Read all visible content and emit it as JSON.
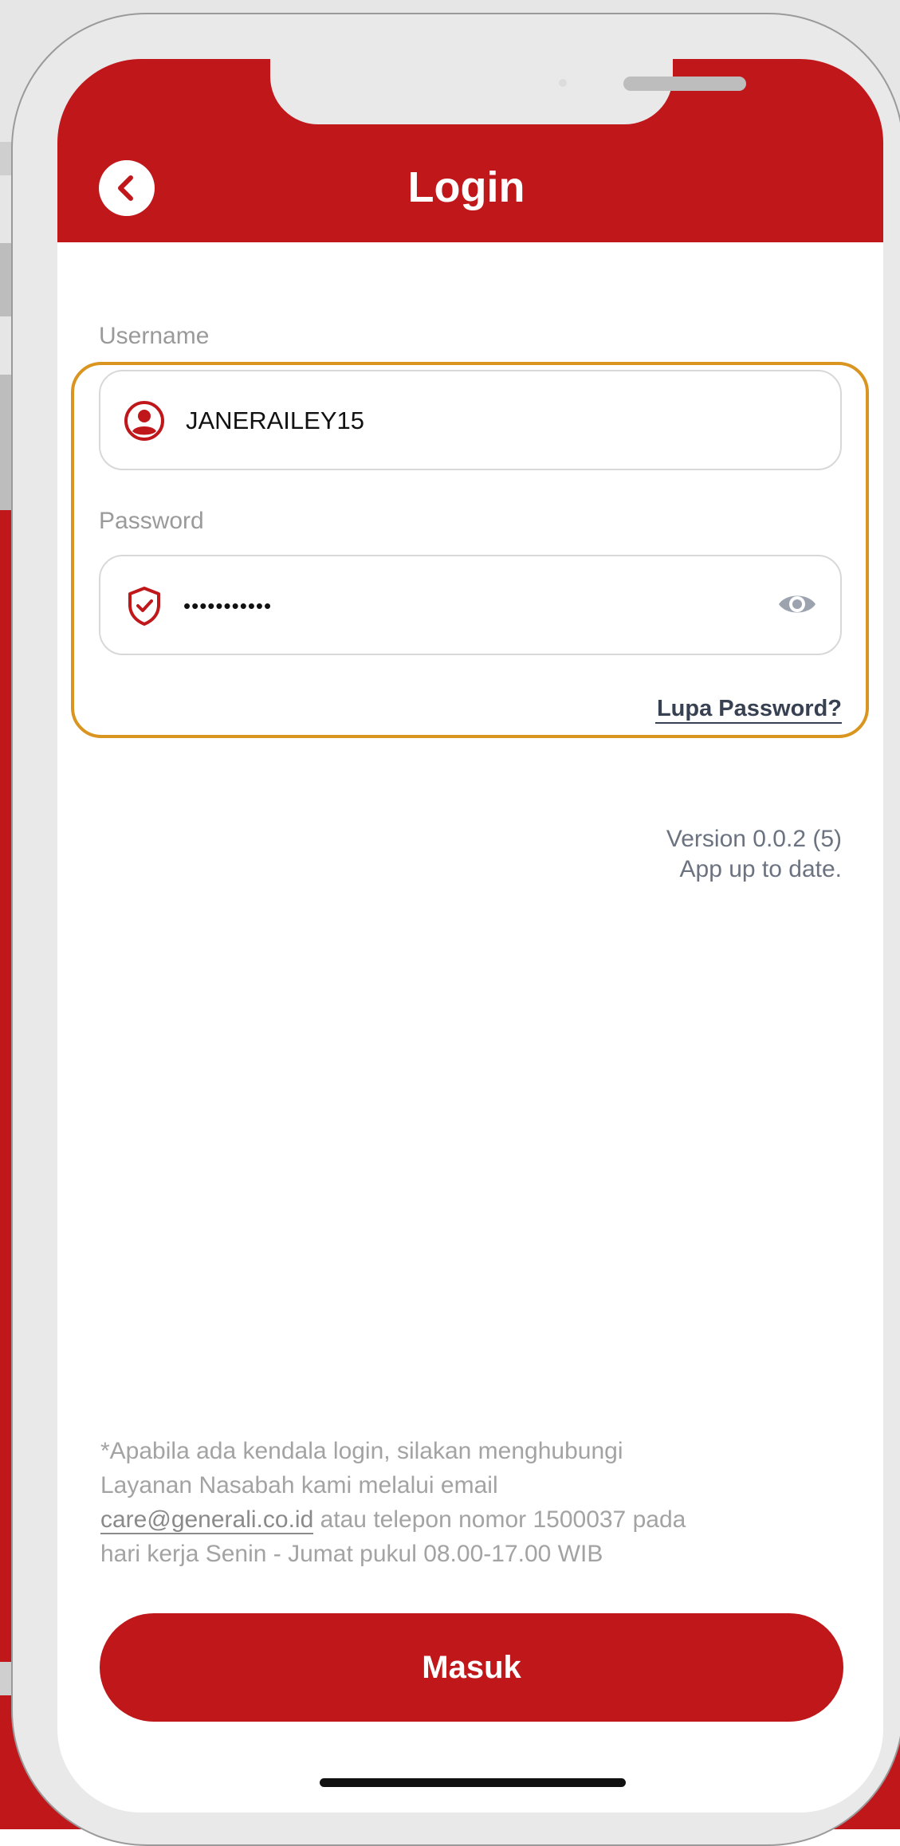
{
  "header": {
    "title": "Login",
    "back_icon": "chevron-left-icon"
  },
  "form": {
    "username_label": "Username",
    "username_value": "JANERAILEY15",
    "username_icon": "user-circle-icon",
    "password_label": "Password",
    "password_value": "•••••••••••",
    "password_icon": "shield-check-icon",
    "password_toggle_icon": "eye-icon",
    "forgot_password": "Lupa Password?"
  },
  "version": {
    "line1": "Version 0.0.2 (5)",
    "line2": "App up to date."
  },
  "help": {
    "line1": "*Apabila ada kendala login, silakan menghubungi",
    "line2": "Layanan Nasabah kami melalui email",
    "email": "care@generali.co.id",
    "line3_rest": " atau telepon nomor 1500037 pada",
    "line4": "hari kerja Senin - Jumat pukul 08.00-17.00 WIB"
  },
  "submit_label": "Masuk",
  "colors": {
    "brand_red": "#c0171b",
    "highlight": "#d9951f",
    "label_gray": "#9a9a9a",
    "link_dark": "#374151"
  }
}
